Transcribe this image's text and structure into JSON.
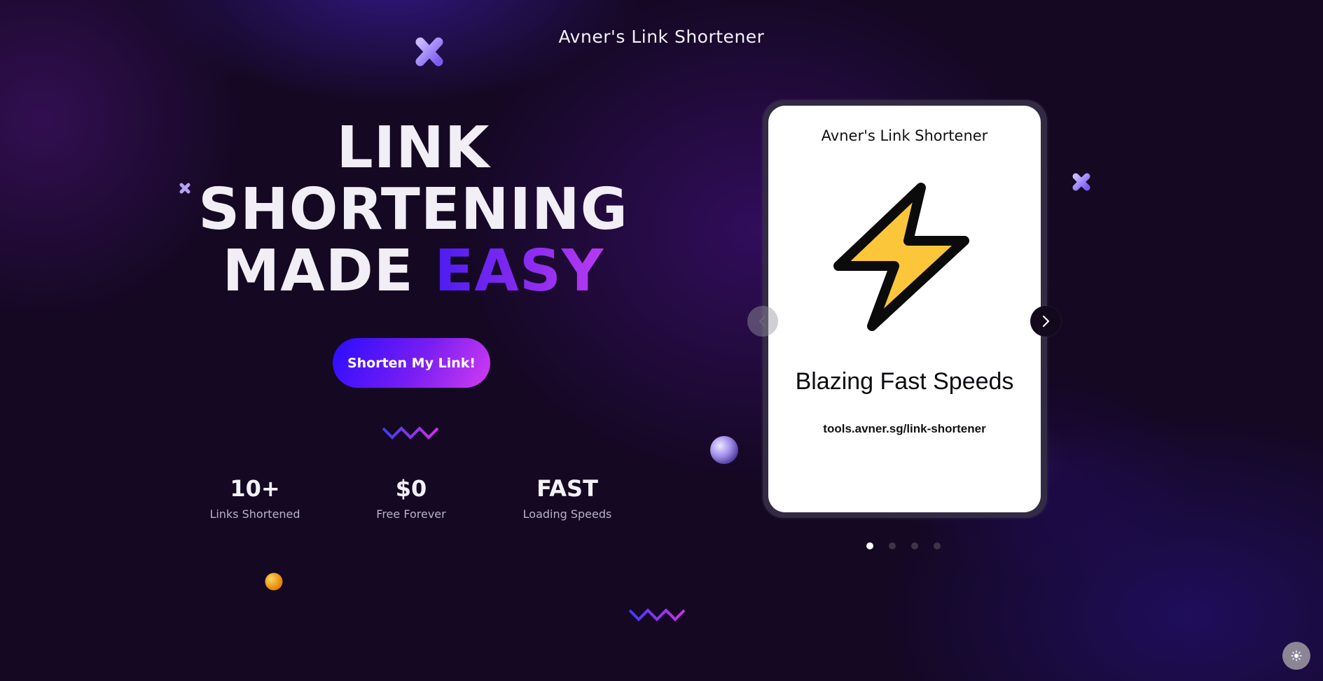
{
  "header": {
    "title": "Avner's Link Shortener"
  },
  "hero": {
    "line1": "LINK",
    "line2": "SHORTENING",
    "line3_start": "MADE",
    "line3_highlight": "EASY",
    "cta_label": "Shorten My Link!"
  },
  "stats": [
    {
      "value": "10+",
      "label": "Links Shortened"
    },
    {
      "value": "$0",
      "label": "Free Forever"
    },
    {
      "value": "FAST",
      "label": "Loading Speeds"
    }
  ],
  "carousel": {
    "slide": {
      "app_title": "Avner's Link Shortener",
      "icon": "lightning-bolt-icon",
      "heading": "Blazing Fast Speeds",
      "url": "tools.avner.sg/link-shortener"
    },
    "slide_count": 4,
    "active_index": 0,
    "prev_icon": "chevron-left-icon",
    "next_icon": "chevron-right-icon"
  },
  "theme_toggle_icon": "sun-icon",
  "colors": {
    "background": "#140822",
    "accent_gradient_start": "#2a0cff",
    "accent_gradient_end": "#d23cf0",
    "bolt_fill": "#fbc63a"
  }
}
